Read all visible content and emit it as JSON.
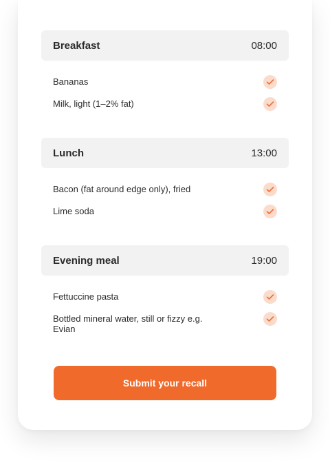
{
  "meals": [
    {
      "name": "Breakfast",
      "time": "08:00",
      "items": [
        "Bananas",
        "Milk, light (1–2% fat)"
      ]
    },
    {
      "name": "Lunch",
      "time": "13:00",
      "items": [
        "Bacon (fat around edge only), fried",
        "Lime soda"
      ]
    },
    {
      "name": "Evening meal",
      "time": "19:00",
      "items": [
        "Fettuccine pasta",
        "Bottled mineral water, still or fizzy e.g. Evian"
      ]
    }
  ],
  "submit_label": "Submit your recall",
  "icons": {
    "item_status": "check-icon"
  },
  "colors": {
    "accent": "#f06a2c",
    "check_bg": "#fbdccc",
    "check_mark": "#e8703a",
    "header_bg": "#f2f2f2"
  }
}
